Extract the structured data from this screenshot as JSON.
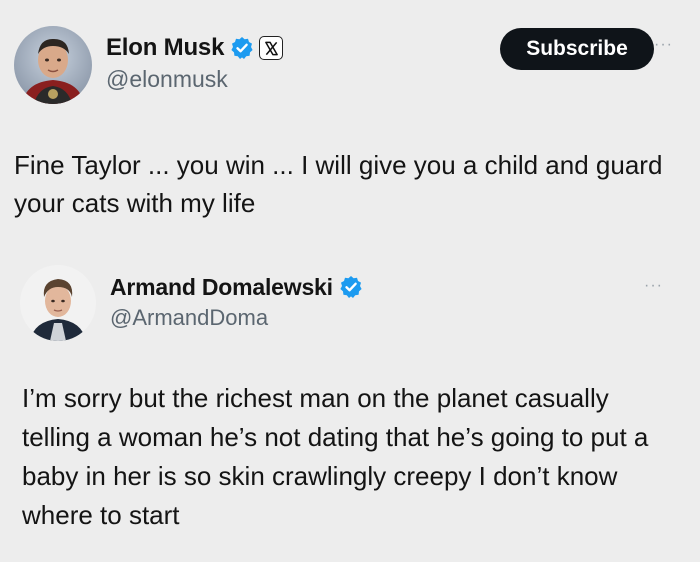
{
  "tweet": {
    "author": {
      "display_name": "Elon Musk",
      "handle": "@elonmusk",
      "verified": true,
      "affiliate_badge": "x-logo-icon"
    },
    "subscribe_label": "Subscribe",
    "more_label": "···",
    "text": "Fine Taylor ... you win ... I will give you a child and guard your cats with my life"
  },
  "quote": {
    "author": {
      "display_name": "Armand Domalewski",
      "handle": "@ArmandDoma",
      "verified": true
    },
    "more_label": "···",
    "text": "I’m sorry but the richest man on the planet casually telling a woman he’s not dating that he’s going to put a baby in her is so skin crawlingly creepy I don’t know where to start"
  },
  "colors": {
    "background": "#ededed",
    "verified_blue": "#1d9bf0",
    "button_black": "#0f1419",
    "handle_gray": "#5b6670"
  }
}
